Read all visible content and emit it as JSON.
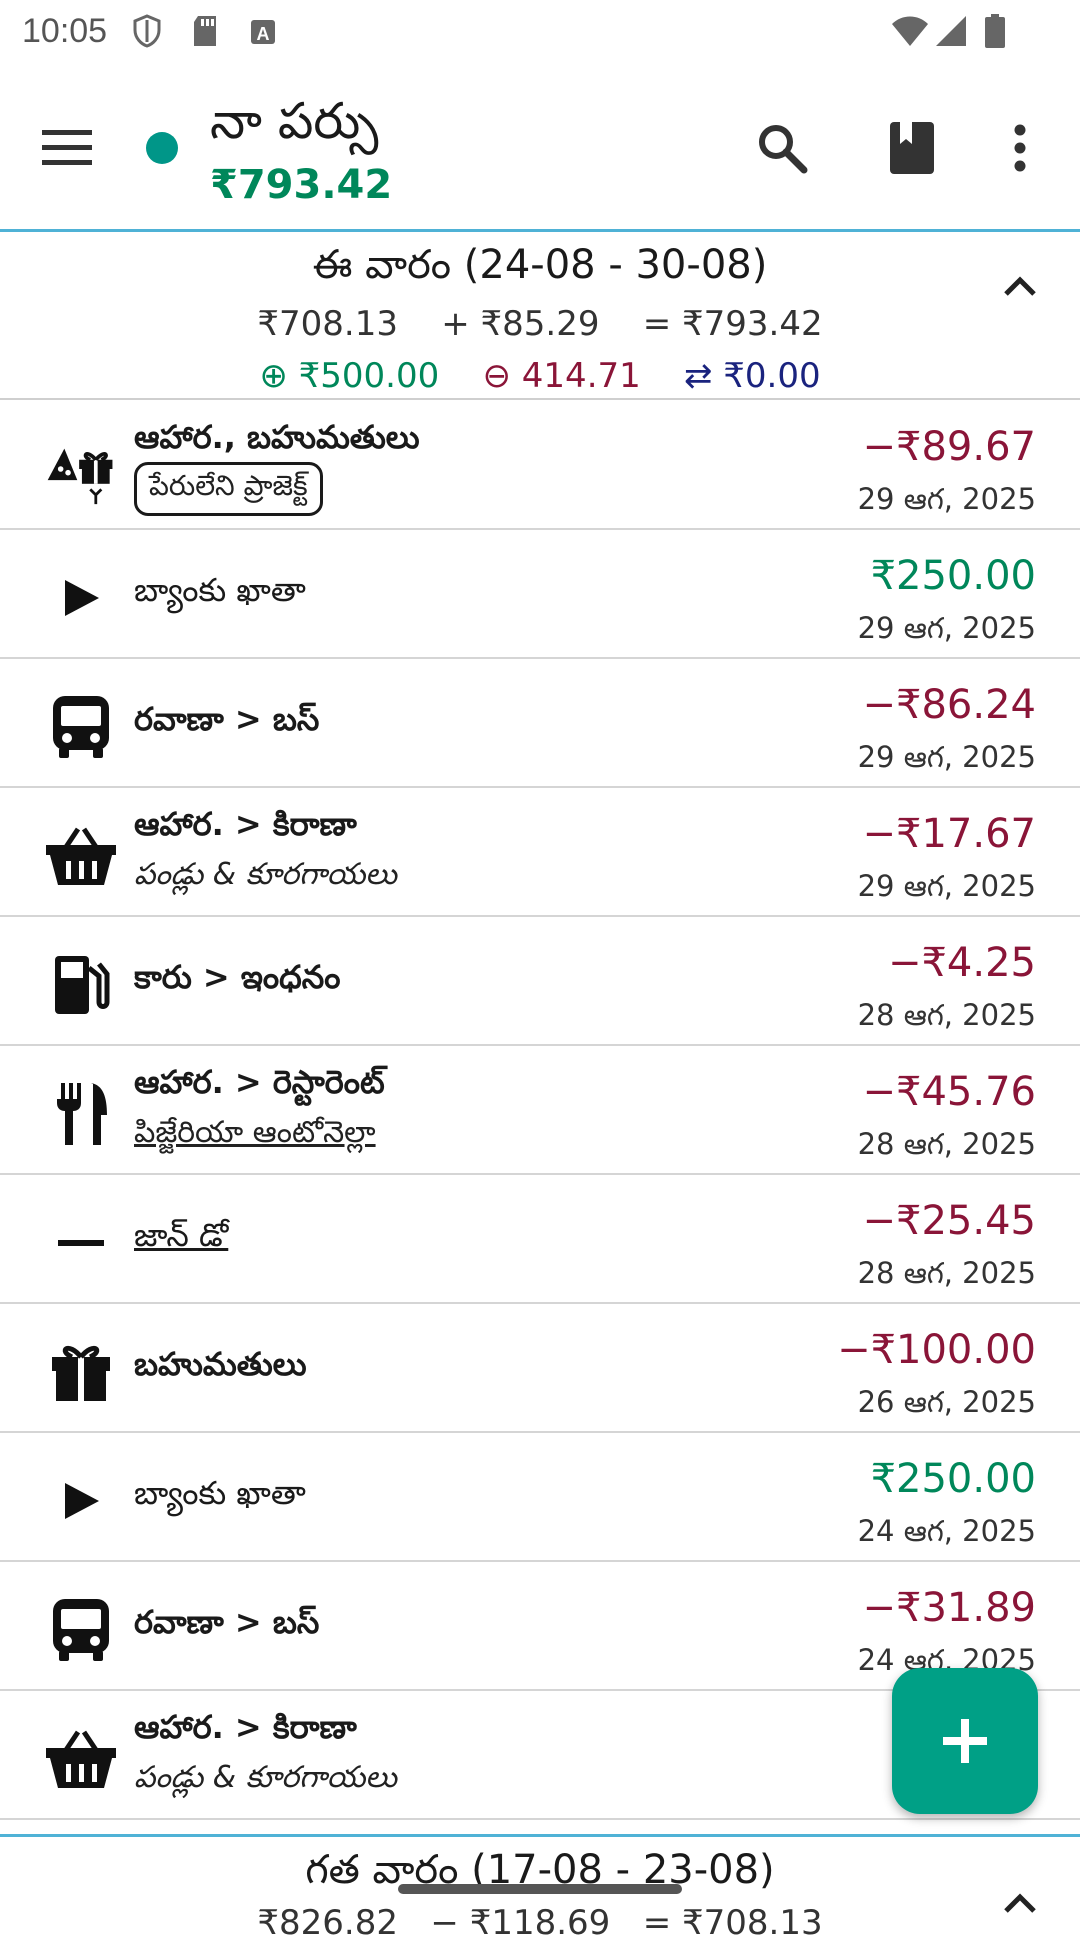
{
  "status_bar": {
    "time": "10:05"
  },
  "app_bar": {
    "title": "నా పర్సు",
    "balance": "₹793.42",
    "colors": {
      "dot": "#009688",
      "balance": "#00875a"
    }
  },
  "week": {
    "title": "ఈ వారం (24-08 - 30-08)",
    "start": "₹708.13",
    "change": "+ ₹85.29",
    "end": "= ₹793.42",
    "income": "⊕ ₹500.00",
    "expense": "⊖ 414.71",
    "transfer": "⇄ ₹0.00"
  },
  "transactions": [
    {
      "icon": "food-gift-icon",
      "line1": "ఆహార., బహుమతులు",
      "line2": "పేరులేని ప్రాజెక్ట్",
      "line2_style": "tag",
      "amount": "−₹89.67",
      "type": "expense",
      "date": "29 ఆగ, 2025"
    },
    {
      "icon": "play-icon",
      "line1": "బ్యాంకు ఖాతా",
      "line2": "",
      "amount": "₹250.00",
      "type": "income",
      "date": "29 ఆగ, 2025"
    },
    {
      "icon": "bus-icon",
      "line1": "రవాణా > బస్",
      "line2": "",
      "amount": "−₹86.24",
      "type": "expense",
      "date": "29 ఆగ, 2025"
    },
    {
      "icon": "basket-icon",
      "line1": "ఆహార. > కిరాణా",
      "line2": "పండ్లు & కూరగాయలు",
      "line2_style": "italic",
      "amount": "−₹17.67",
      "type": "expense",
      "date": "29 ఆగ, 2025"
    },
    {
      "icon": "fuel-icon",
      "line1": "కారు > ఇంధనం",
      "line2": "",
      "amount": "−₹4.25",
      "type": "expense",
      "date": "28 ఆగ, 2025"
    },
    {
      "icon": "restaurant-icon",
      "line1": "ఆహార. > రెస్టారెంట్",
      "line2": "పిజ్జేరియా ఆంటోనెల్లా",
      "line2_style": "under",
      "amount": "−₹45.76",
      "type": "expense",
      "date": "28 ఆగ, 2025"
    },
    {
      "icon": "minus-icon",
      "line1": "జాన్ డో",
      "line2": "",
      "line1_style": "under-plain",
      "amount": "−₹25.45",
      "type": "expense",
      "date": "28 ఆగ, 2025"
    },
    {
      "icon": "gift-icon",
      "line1": "బహుమతులు",
      "line2": "",
      "amount": "−₹100.00",
      "type": "expense",
      "date": "26 ఆగ, 2025"
    },
    {
      "icon": "play-icon",
      "line1": "బ్యాంకు ఖాతా",
      "line2": "",
      "amount": "₹250.00",
      "type": "income",
      "date": "24 ఆగ, 2025"
    },
    {
      "icon": "bus-icon",
      "line1": "రవాణా > బస్",
      "line2": "",
      "amount": "−₹31.89",
      "type": "expense",
      "date": "24 ఆగ, 2025"
    },
    {
      "icon": "basket-icon",
      "line1": "ఆహార. > కిరాణా",
      "line2": "పండ్లు & కూరగాయలు",
      "line2_style": "italic",
      "amount": "−",
      "type": "expense",
      "date": "24"
    }
  ],
  "next_week": {
    "title": "గత వారం (17-08 - 23-08)",
    "sums": "₹826.82   − ₹118.69   = ₹708.13"
  },
  "colors": {
    "income": "#00875a",
    "expense": "#8a1538",
    "transfer": "#1a237e",
    "accent": "#4fb2d6",
    "fab": "#00a086"
  }
}
